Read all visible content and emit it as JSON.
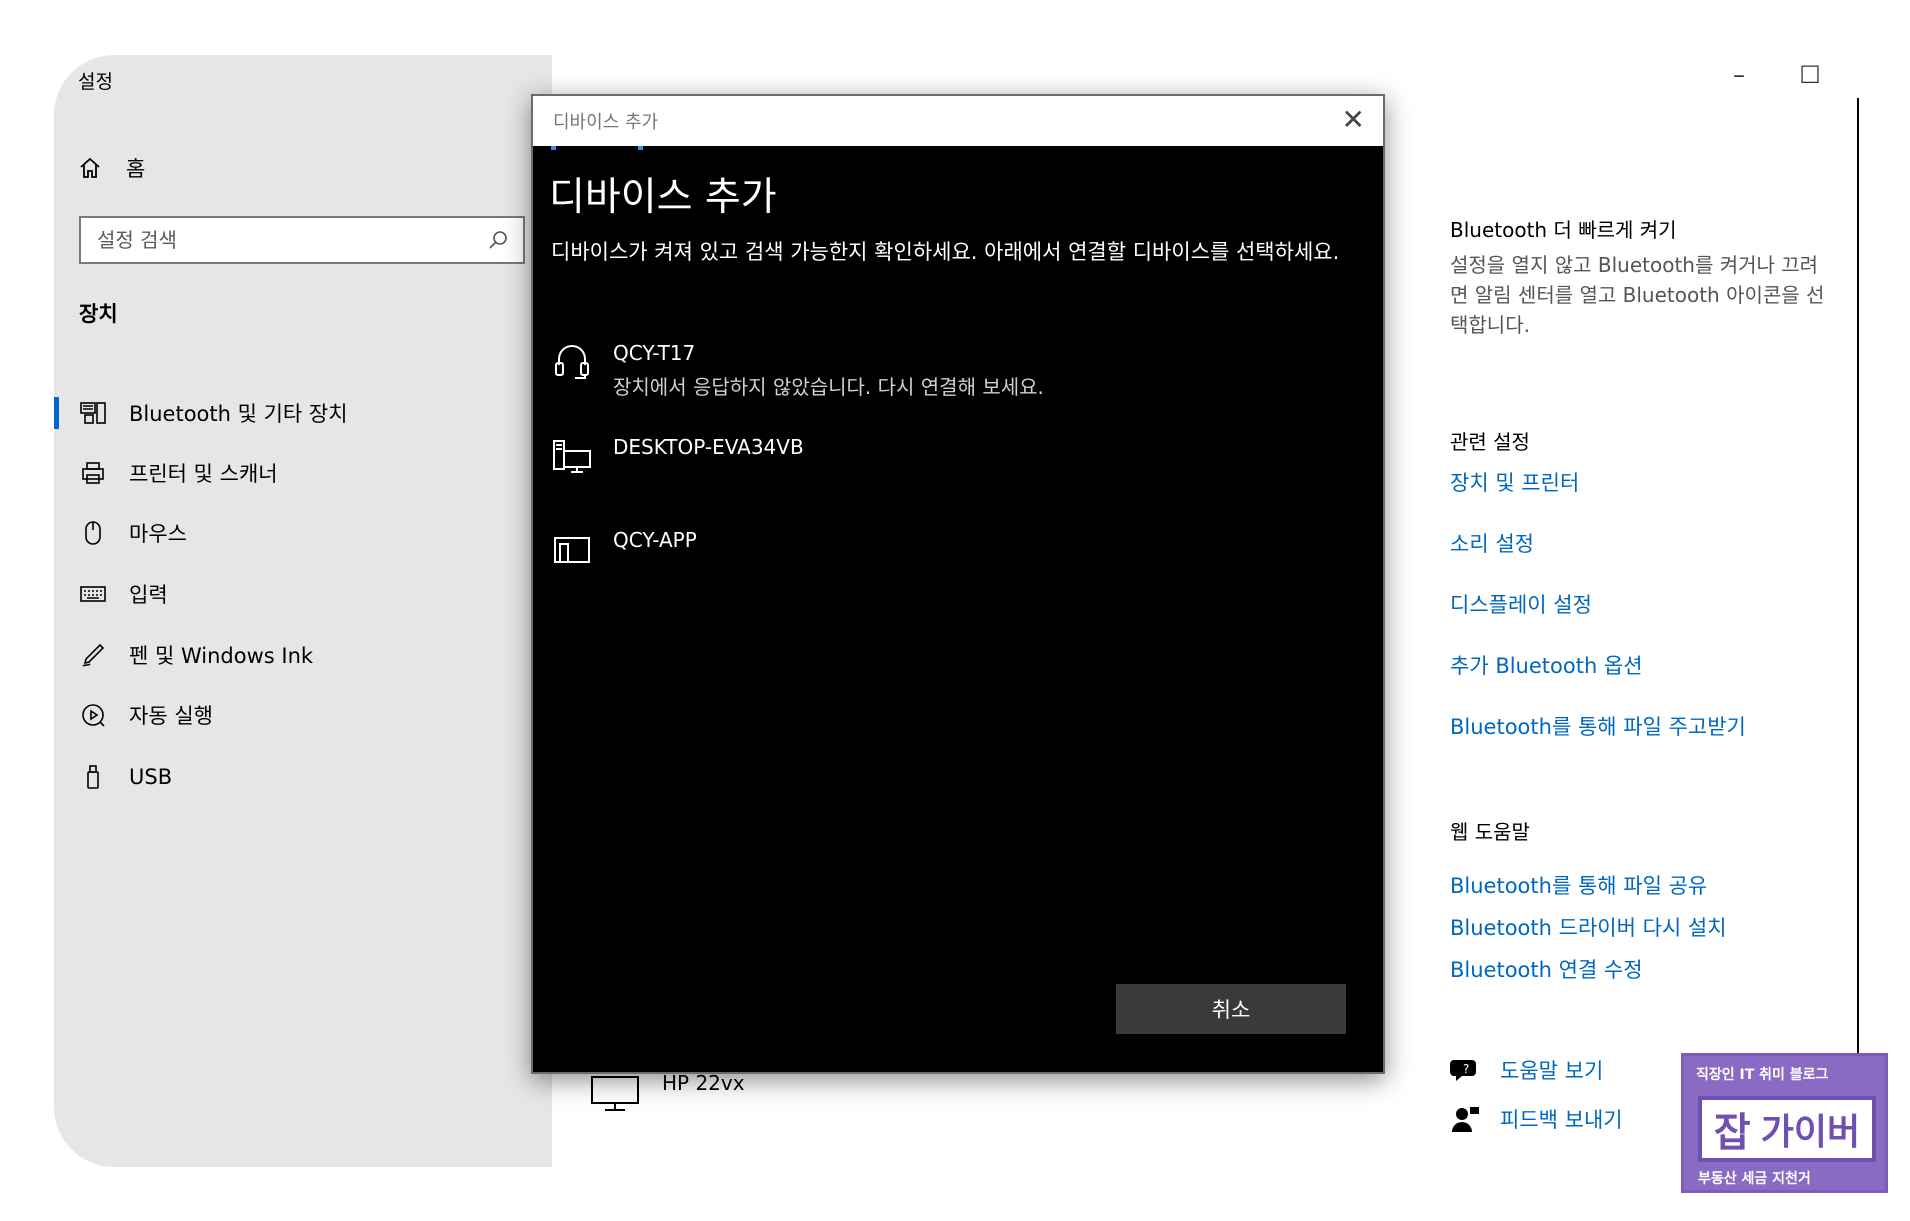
{
  "window": {
    "app_title": "설정",
    "controls": {
      "minimize": "–",
      "maximize": "☐",
      "close": "✕"
    }
  },
  "sidebar": {
    "home_label": "홈",
    "search_placeholder": "설정 검색",
    "section_title": "장치",
    "items": [
      {
        "label": "Bluetooth 및 기타 장치",
        "icon": "bluetooth-devices-icon",
        "active": true
      },
      {
        "label": "프린터 및 스캐너",
        "icon": "printer-icon"
      },
      {
        "label": "마우스",
        "icon": "mouse-icon"
      },
      {
        "label": "입력",
        "icon": "keyboard-icon"
      },
      {
        "label": "펜 및 Windows Ink",
        "icon": "pen-icon"
      },
      {
        "label": "자동 실행",
        "icon": "autoplay-icon"
      },
      {
        "label": "USB",
        "icon": "usb-icon"
      }
    ]
  },
  "main": {
    "background_device": "HP 22vx"
  },
  "right_panel": {
    "quick_title": "Bluetooth 더 빠르게 켜기",
    "quick_desc": "설정을 열지 않고 Bluetooth를 켜거나 끄려면 알림 센터를 열고 Bluetooth 아이콘을 선택합니다.",
    "related_title": "관련 설정",
    "related_links": [
      "장치 및 프린터",
      "소리 설정",
      "디스플레이 설정",
      "추가 Bluetooth 옵션",
      "Bluetooth를 통해 파일 주고받기"
    ],
    "web_help_title": "웹 도움말",
    "web_help_links": [
      "Bluetooth를 통해 파일 공유",
      "Bluetooth 드라이버 다시 설치",
      "Bluetooth 연결 수정"
    ],
    "help_label": "도움말 보기",
    "feedback_label": "피드백 보내기"
  },
  "dialog": {
    "bar_title": "디바이스 추가",
    "title": "디바이스 추가",
    "description": "디바이스가 켜져 있고 검색 가능한지 확인하세요. 아래에서 연결할 디바이스를 선택하세요.",
    "devices": [
      {
        "name": "QCY-T17",
        "status": "장치에서 응답하지 않았습니다. 다시 연결해 보세요.",
        "icon": "headset-icon"
      },
      {
        "name": "DESKTOP-EVA34VB",
        "status": "",
        "icon": "desktop-pc-icon"
      },
      {
        "name": "QCY-APP",
        "status": "",
        "icon": "device-icon"
      }
    ],
    "cancel_label": "취소"
  },
  "watermark": {
    "top": "직장인 IT 취미 블로그",
    "main_1": "잡",
    "main_2": "가이버",
    "bottom": "부동산 세금 지천거"
  },
  "colors": {
    "accent": "#0067c0",
    "sidebar_bg": "#e6e6e6",
    "dialog_bg": "#000000",
    "watermark": "#8a6bc4"
  }
}
